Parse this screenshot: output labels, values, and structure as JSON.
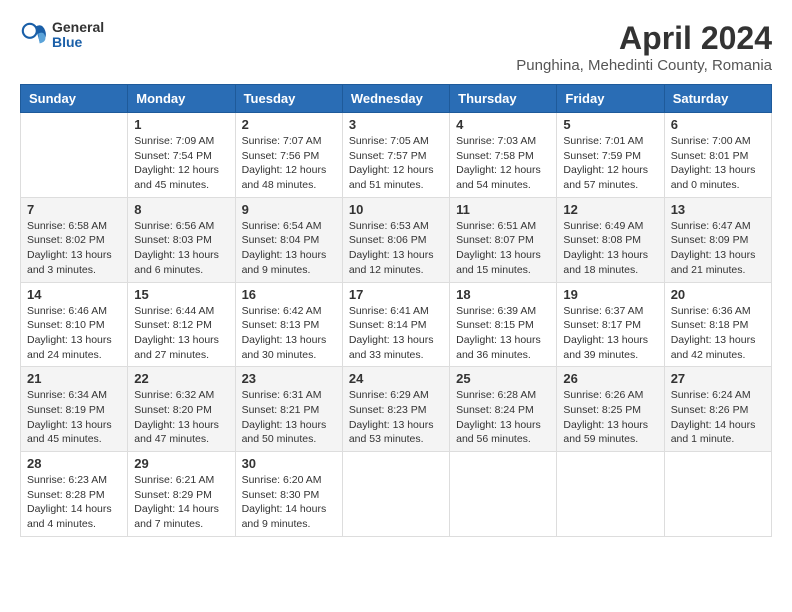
{
  "header": {
    "logo_general": "General",
    "logo_blue": "Blue",
    "month_year": "April 2024",
    "location": "Punghina, Mehedinti County, Romania"
  },
  "days_of_week": [
    "Sunday",
    "Monday",
    "Tuesday",
    "Wednesday",
    "Thursday",
    "Friday",
    "Saturday"
  ],
  "weeks": [
    [
      {
        "day": "",
        "info": ""
      },
      {
        "day": "1",
        "info": "Sunrise: 7:09 AM\nSunset: 7:54 PM\nDaylight: 12 hours\nand 45 minutes."
      },
      {
        "day": "2",
        "info": "Sunrise: 7:07 AM\nSunset: 7:56 PM\nDaylight: 12 hours\nand 48 minutes."
      },
      {
        "day": "3",
        "info": "Sunrise: 7:05 AM\nSunset: 7:57 PM\nDaylight: 12 hours\nand 51 minutes."
      },
      {
        "day": "4",
        "info": "Sunrise: 7:03 AM\nSunset: 7:58 PM\nDaylight: 12 hours\nand 54 minutes."
      },
      {
        "day": "5",
        "info": "Sunrise: 7:01 AM\nSunset: 7:59 PM\nDaylight: 12 hours\nand 57 minutes."
      },
      {
        "day": "6",
        "info": "Sunrise: 7:00 AM\nSunset: 8:01 PM\nDaylight: 13 hours\nand 0 minutes."
      }
    ],
    [
      {
        "day": "7",
        "info": "Sunrise: 6:58 AM\nSunset: 8:02 PM\nDaylight: 13 hours\nand 3 minutes."
      },
      {
        "day": "8",
        "info": "Sunrise: 6:56 AM\nSunset: 8:03 PM\nDaylight: 13 hours\nand 6 minutes."
      },
      {
        "day": "9",
        "info": "Sunrise: 6:54 AM\nSunset: 8:04 PM\nDaylight: 13 hours\nand 9 minutes."
      },
      {
        "day": "10",
        "info": "Sunrise: 6:53 AM\nSunset: 8:06 PM\nDaylight: 13 hours\nand 12 minutes."
      },
      {
        "day": "11",
        "info": "Sunrise: 6:51 AM\nSunset: 8:07 PM\nDaylight: 13 hours\nand 15 minutes."
      },
      {
        "day": "12",
        "info": "Sunrise: 6:49 AM\nSunset: 8:08 PM\nDaylight: 13 hours\nand 18 minutes."
      },
      {
        "day": "13",
        "info": "Sunrise: 6:47 AM\nSunset: 8:09 PM\nDaylight: 13 hours\nand 21 minutes."
      }
    ],
    [
      {
        "day": "14",
        "info": "Sunrise: 6:46 AM\nSunset: 8:10 PM\nDaylight: 13 hours\nand 24 minutes."
      },
      {
        "day": "15",
        "info": "Sunrise: 6:44 AM\nSunset: 8:12 PM\nDaylight: 13 hours\nand 27 minutes."
      },
      {
        "day": "16",
        "info": "Sunrise: 6:42 AM\nSunset: 8:13 PM\nDaylight: 13 hours\nand 30 minutes."
      },
      {
        "day": "17",
        "info": "Sunrise: 6:41 AM\nSunset: 8:14 PM\nDaylight: 13 hours\nand 33 minutes."
      },
      {
        "day": "18",
        "info": "Sunrise: 6:39 AM\nSunset: 8:15 PM\nDaylight: 13 hours\nand 36 minutes."
      },
      {
        "day": "19",
        "info": "Sunrise: 6:37 AM\nSunset: 8:17 PM\nDaylight: 13 hours\nand 39 minutes."
      },
      {
        "day": "20",
        "info": "Sunrise: 6:36 AM\nSunset: 8:18 PM\nDaylight: 13 hours\nand 42 minutes."
      }
    ],
    [
      {
        "day": "21",
        "info": "Sunrise: 6:34 AM\nSunset: 8:19 PM\nDaylight: 13 hours\nand 45 minutes."
      },
      {
        "day": "22",
        "info": "Sunrise: 6:32 AM\nSunset: 8:20 PM\nDaylight: 13 hours\nand 47 minutes."
      },
      {
        "day": "23",
        "info": "Sunrise: 6:31 AM\nSunset: 8:21 PM\nDaylight: 13 hours\nand 50 minutes."
      },
      {
        "day": "24",
        "info": "Sunrise: 6:29 AM\nSunset: 8:23 PM\nDaylight: 13 hours\nand 53 minutes."
      },
      {
        "day": "25",
        "info": "Sunrise: 6:28 AM\nSunset: 8:24 PM\nDaylight: 13 hours\nand 56 minutes."
      },
      {
        "day": "26",
        "info": "Sunrise: 6:26 AM\nSunset: 8:25 PM\nDaylight: 13 hours\nand 59 minutes."
      },
      {
        "day": "27",
        "info": "Sunrise: 6:24 AM\nSunset: 8:26 PM\nDaylight: 14 hours\nand 1 minute."
      }
    ],
    [
      {
        "day": "28",
        "info": "Sunrise: 6:23 AM\nSunset: 8:28 PM\nDaylight: 14 hours\nand 4 minutes."
      },
      {
        "day": "29",
        "info": "Sunrise: 6:21 AM\nSunset: 8:29 PM\nDaylight: 14 hours\nand 7 minutes."
      },
      {
        "day": "30",
        "info": "Sunrise: 6:20 AM\nSunset: 8:30 PM\nDaylight: 14 hours\nand 9 minutes."
      },
      {
        "day": "",
        "info": ""
      },
      {
        "day": "",
        "info": ""
      },
      {
        "day": "",
        "info": ""
      },
      {
        "day": "",
        "info": ""
      }
    ]
  ]
}
